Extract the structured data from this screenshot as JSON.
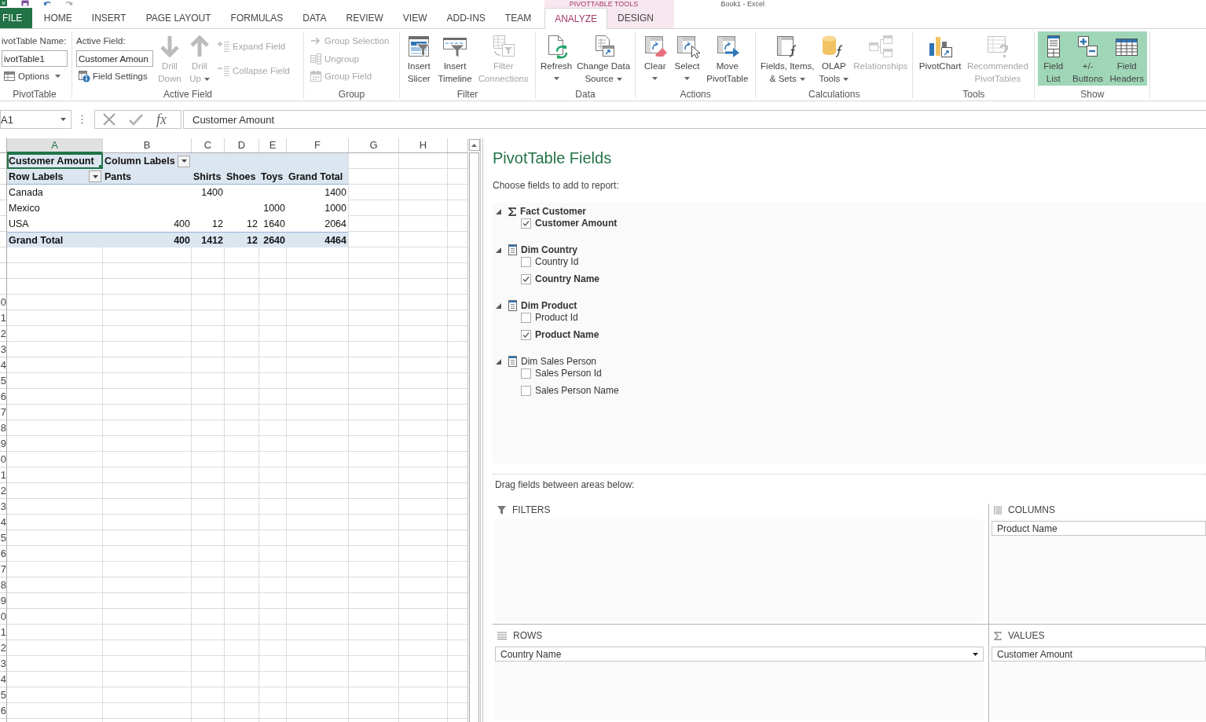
{
  "title_bar": {
    "context_label": "PIVOTTABLE TOOLS",
    "title": "Book1 - Excel"
  },
  "tabs": [
    {
      "label": "FILE",
      "kind": "file",
      "selected": false
    },
    {
      "label": "HOME",
      "kind": "normal",
      "selected": false
    },
    {
      "label": "INSERT",
      "kind": "normal",
      "selected": false
    },
    {
      "label": "PAGE LAYOUT",
      "kind": "normal",
      "selected": false
    },
    {
      "label": "FORMULAS",
      "kind": "normal",
      "selected": false
    },
    {
      "label": "DATA",
      "kind": "normal",
      "selected": false
    },
    {
      "label": "REVIEW",
      "kind": "normal",
      "selected": false
    },
    {
      "label": "VIEW",
      "kind": "normal",
      "selected": false
    },
    {
      "label": "ADD-INS",
      "kind": "normal",
      "selected": false
    },
    {
      "label": "TEAM",
      "kind": "normal",
      "selected": false
    },
    {
      "label": "ANALYZE",
      "kind": "contextual",
      "selected": true
    },
    {
      "label": "DESIGN",
      "kind": "contextual",
      "selected": false
    }
  ],
  "ribbon": {
    "groups": [
      {
        "label": "PivotTable",
        "items": [
          {
            "kind": "stack",
            "items": [
              {
                "kind": "label",
                "text": "ivotTable Name:"
              },
              {
                "kind": "input",
                "value": "ivotTable1"
              },
              {
                "kind": "small",
                "label": "Options",
                "disabled": false,
                "menu": true
              }
            ]
          }
        ]
      },
      {
        "label": "Active Field",
        "items": [
          {
            "kind": "stack",
            "items": [
              {
                "kind": "label",
                "text": "Active Field:"
              },
              {
                "kind": "input",
                "value": "Customer Amoun"
              },
              {
                "kind": "small",
                "label": "Field Settings",
                "disabled": false,
                "menu": false
              }
            ]
          },
          {
            "kind": "large",
            "label": "Drill\nDown",
            "disabled": true,
            "menu": false
          },
          {
            "kind": "large",
            "label": "Drill\nUp",
            "disabled": true,
            "menu": true
          },
          {
            "kind": "stack",
            "items": [
              {
                "kind": "small",
                "label": "Expand Field",
                "disabled": true,
                "menu": false
              },
              {
                "kind": "small",
                "label": "Collapse Field",
                "disabled": true,
                "menu": false
              }
            ]
          }
        ]
      },
      {
        "label": "Group",
        "items": [
          {
            "kind": "stack",
            "items": [
              {
                "kind": "small",
                "label": "Group Selection",
                "disabled": true,
                "menu": false
              },
              {
                "kind": "small",
                "label": "Ungroup",
                "disabled": true,
                "menu": false
              },
              {
                "kind": "small",
                "label": "Group Field",
                "disabled": true,
                "menu": false
              }
            ]
          }
        ]
      },
      {
        "label": "Filter",
        "items": [
          {
            "kind": "large",
            "label": "Insert\nSlicer",
            "disabled": false,
            "menu": false
          },
          {
            "kind": "large",
            "label": "Insert\nTimeline",
            "disabled": false,
            "menu": false
          },
          {
            "kind": "large",
            "label": "Filter\nConnections",
            "disabled": true,
            "menu": false
          }
        ]
      },
      {
        "label": "Data",
        "items": [
          {
            "kind": "large",
            "label": "Refresh",
            "disabled": false,
            "menu": true
          },
          {
            "kind": "large",
            "label": "Change Data\nSource",
            "disabled": false,
            "menu": true
          }
        ]
      },
      {
        "label": "Actions",
        "items": [
          {
            "kind": "large",
            "label": "Clear",
            "disabled": false,
            "menu": true
          },
          {
            "kind": "large",
            "label": "Select",
            "disabled": false,
            "menu": true
          },
          {
            "kind": "large",
            "label": "Move\nPivotTable",
            "disabled": false,
            "menu": false
          }
        ]
      },
      {
        "label": "Calculations",
        "items": [
          {
            "kind": "large",
            "label": "Fields, Items,\n& Sets",
            "disabled": false,
            "menu": true
          },
          {
            "kind": "large",
            "label": "OLAP\nTools",
            "disabled": false,
            "menu": true
          },
          {
            "kind": "large",
            "label": "Relationships",
            "disabled": true,
            "menu": false
          }
        ]
      },
      {
        "label": "Tools",
        "items": [
          {
            "kind": "large",
            "label": "PivotChart",
            "disabled": false,
            "menu": false
          },
          {
            "kind": "large",
            "label": "Recommended\nPivotTables",
            "disabled": true,
            "menu": false
          }
        ]
      },
      {
        "label": "Show",
        "items": [
          {
            "kind": "toggle",
            "label": "Field\nList",
            "on": true
          },
          {
            "kind": "toggle",
            "label": "+/-\nButtons",
            "on": true
          },
          {
            "kind": "toggle",
            "label": "Field\nHeaders",
            "on": true
          }
        ]
      }
    ]
  },
  "formula_bar": {
    "name_box": "A1",
    "function_label": "fx",
    "formula": "Customer Amount"
  },
  "sheet": {
    "columns": [
      {
        "label": "A",
        "selected": true
      },
      {
        "label": "B",
        "selected": false
      },
      {
        "label": "C",
        "selected": false
      },
      {
        "label": "D",
        "selected": false
      },
      {
        "label": "E",
        "selected": false
      },
      {
        "label": "F",
        "selected": false
      },
      {
        "label": "G",
        "selected": false
      },
      {
        "label": "H",
        "selected": false
      }
    ],
    "row_numbers": [
      "0",
      "1",
      "2",
      "3",
      "4",
      "5",
      "6",
      "7",
      "8",
      "9",
      "0",
      "1",
      "2",
      "3",
      "4",
      "5",
      "6",
      "7",
      "8",
      "9",
      "0",
      "1",
      "2",
      "3",
      "4",
      "5",
      "6"
    ],
    "pivot_rows": [
      {
        "kind": "title",
        "cells": [
          {
            "text": "Customer Amount",
            "selected": true,
            "dropdown": false
          },
          {
            "text": "Column Labels",
            "selected": false,
            "dropdown": true
          },
          null,
          null,
          null,
          null
        ]
      },
      {
        "kind": "header",
        "cells": [
          {
            "text": "Row Labels",
            "selected": false,
            "dropdown": true
          },
          {
            "text": "Pants",
            "selected": false,
            "dropdown": false
          },
          {
            "text": "Shirts",
            "selected": false,
            "dropdown": false
          },
          {
            "text": "Shoes",
            "selected": false,
            "dropdown": false
          },
          {
            "text": "Toys",
            "selected": false,
            "dropdown": false
          },
          {
            "text": "Grand Total",
            "selected": false,
            "dropdown": false
          }
        ]
      },
      {
        "kind": "item",
        "cells": [
          {
            "text": "Canada",
            "selected": false,
            "dropdown": false
          },
          null,
          {
            "text": "1400",
            "selected": false,
            "dropdown": false
          },
          null,
          null,
          {
            "text": "1400",
            "selected": false,
            "dropdown": false
          }
        ]
      },
      {
        "kind": "item",
        "cells": [
          {
            "text": "Mexico",
            "selected": false,
            "dropdown": false
          },
          null,
          null,
          null,
          {
            "text": "1000",
            "selected": false,
            "dropdown": false
          },
          {
            "text": "1000",
            "selected": false,
            "dropdown": false
          }
        ]
      },
      {
        "kind": "item",
        "cells": [
          {
            "text": "USA",
            "selected": false,
            "dropdown": false
          },
          {
            "text": "400",
            "selected": false,
            "dropdown": false
          },
          {
            "text": "12",
            "selected": false,
            "dropdown": false
          },
          {
            "text": "12",
            "selected": false,
            "dropdown": false
          },
          {
            "text": "1640",
            "selected": false,
            "dropdown": false
          },
          {
            "text": "2064",
            "selected": false,
            "dropdown": false
          }
        ]
      },
      {
        "kind": "total",
        "cells": [
          {
            "text": "Grand Total",
            "selected": false,
            "dropdown": false
          },
          {
            "text": "400",
            "selected": false,
            "dropdown": false
          },
          {
            "text": "1412",
            "selected": false,
            "dropdown": false
          },
          {
            "text": "12",
            "selected": false,
            "dropdown": false
          },
          {
            "text": "2640",
            "selected": false,
            "dropdown": false
          },
          {
            "text": "4464",
            "selected": false,
            "dropdown": false
          }
        ]
      }
    ]
  },
  "field_list": {
    "title": "PivotTable Fields",
    "prompt": "Choose fields to add to report:",
    "tables": [
      {
        "name": "Fact Customer",
        "kind": "measure",
        "expanded": true,
        "fields": [
          {
            "name": "Customer Amount",
            "checked": true
          }
        ]
      },
      {
        "name": "Dim Country",
        "kind": "dimension",
        "expanded": true,
        "fields": [
          {
            "name": "Country Id",
            "checked": false
          },
          {
            "name": "Country Name",
            "checked": true
          }
        ]
      },
      {
        "name": "Dim Product",
        "kind": "dimension",
        "expanded": true,
        "fields": [
          {
            "name": "Product Id",
            "checked": false
          },
          {
            "name": "Product Name",
            "checked": true
          }
        ]
      },
      {
        "name": "Dim Sales Person",
        "kind": "dimension",
        "expanded": true,
        "fields": [
          {
            "name": "Sales Person Id",
            "checked": false
          },
          {
            "name": "Sales Person Name",
            "checked": false
          }
        ]
      }
    ],
    "areas_prompt": "Drag fields between areas below:",
    "areas": [
      {
        "label": "FILTERS",
        "kind": "filters"
      },
      {
        "label": "COLUMNS",
        "kind": "columns",
        "fields": [
          {
            "name": "Product Name",
            "menu": false
          }
        ]
      },
      {
        "label": "ROWS",
        "kind": "rows",
        "fields": [
          {
            "name": "Country Name",
            "menu": true
          }
        ]
      },
      {
        "label": "VALUES",
        "kind": "values",
        "fields": [
          {
            "name": "Customer Amount",
            "menu": false
          }
        ]
      }
    ]
  }
}
